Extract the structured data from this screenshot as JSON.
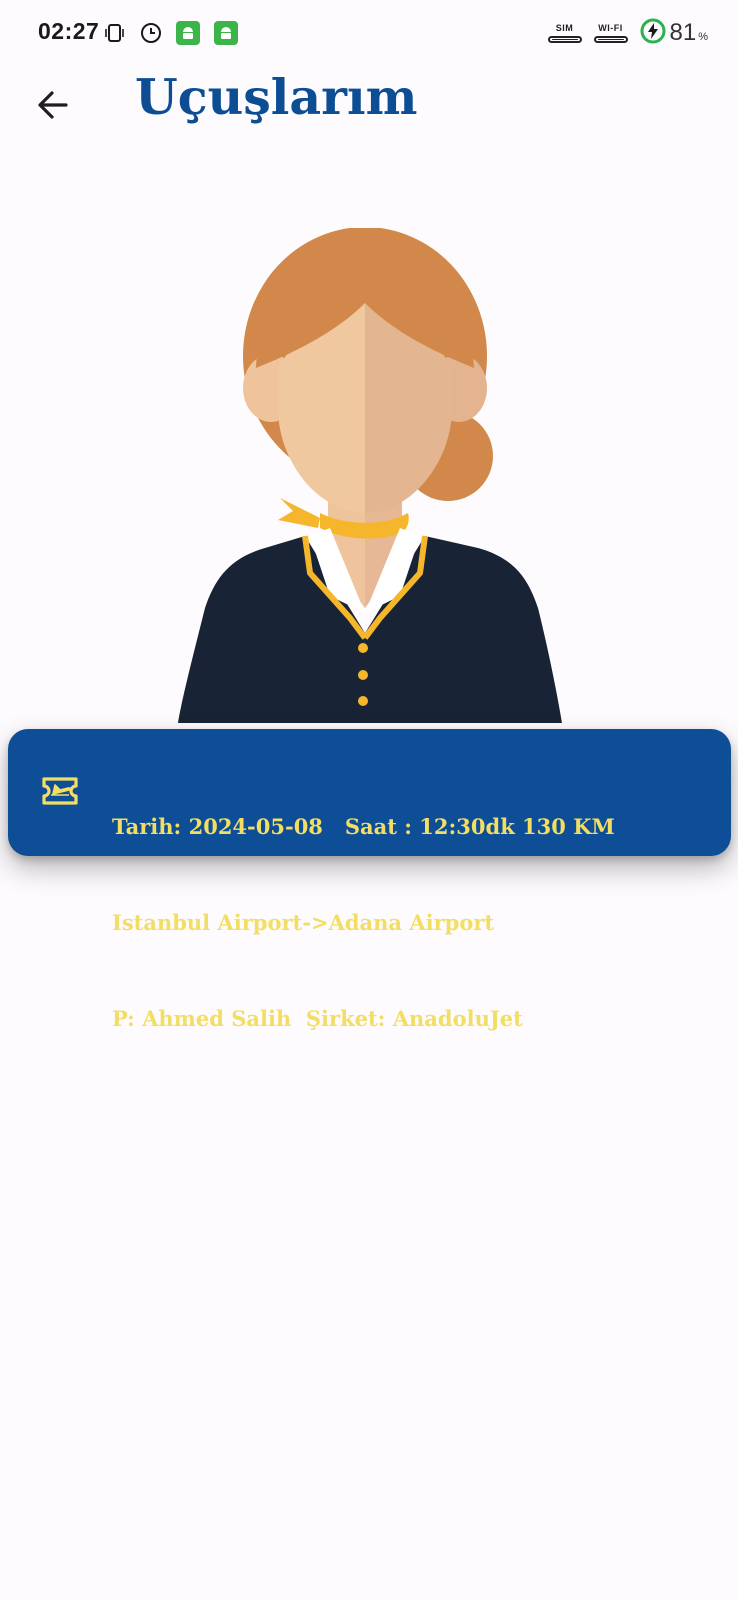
{
  "status_bar": {
    "time": "02:27",
    "sim_label": "SIM",
    "wifi_label": "WI-FI",
    "battery_percent": "81",
    "battery_unit": "%"
  },
  "header": {
    "title": "Uçuşlarım",
    "back_icon": "arrow-left-icon"
  },
  "colors": {
    "title": "#0d4d93",
    "card_background": "#0e4e96",
    "card_text": "#f3dd63",
    "page_background": "#fdfbfd"
  },
  "flights": [
    {
      "icon": "flight-ticket-icon",
      "line1": "Tarih: 2024-05-08   Saat : 12:30dk 130 KM",
      "line2": "Istanbul Airport->Adana Airport",
      "line3": "P: Ahmed Salih  Şirket: AnadoluJet"
    }
  ]
}
